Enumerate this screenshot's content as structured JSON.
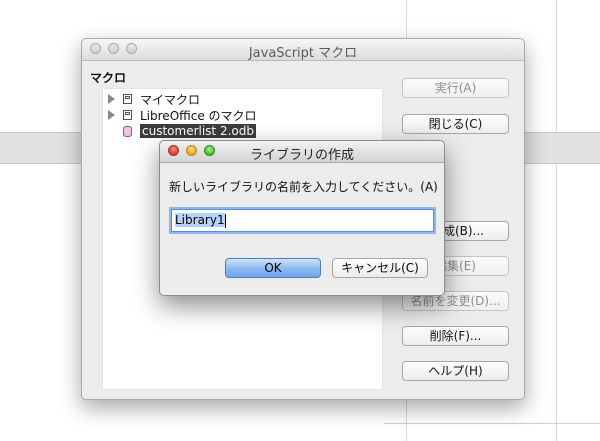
{
  "main_window": {
    "title": "JavaScript マクロ",
    "section_label": "マクロ",
    "tree": [
      {
        "label": "マイマクロ",
        "icon": "container-icon"
      },
      {
        "label": "LibreOffice のマクロ",
        "icon": "container-icon"
      },
      {
        "label": "customerlist 2.odb",
        "icon": "database-icon",
        "selected": true
      }
    ],
    "buttons": {
      "run": "実行(A)",
      "close": "閉じる(C)",
      "create_partial": "成(B)...",
      "edit_partial": "編集(E)",
      "rename": "名前を変更(D)...",
      "delete": "削除(F)...",
      "help": "ヘルプ(H)"
    }
  },
  "dialog": {
    "title": "ライブラリの作成",
    "prompt": "新しいライブラリの名前を入力してください。(A)",
    "input_value": "Library1",
    "ok_label": "OK",
    "cancel_label": "キャンセル(C)"
  }
}
